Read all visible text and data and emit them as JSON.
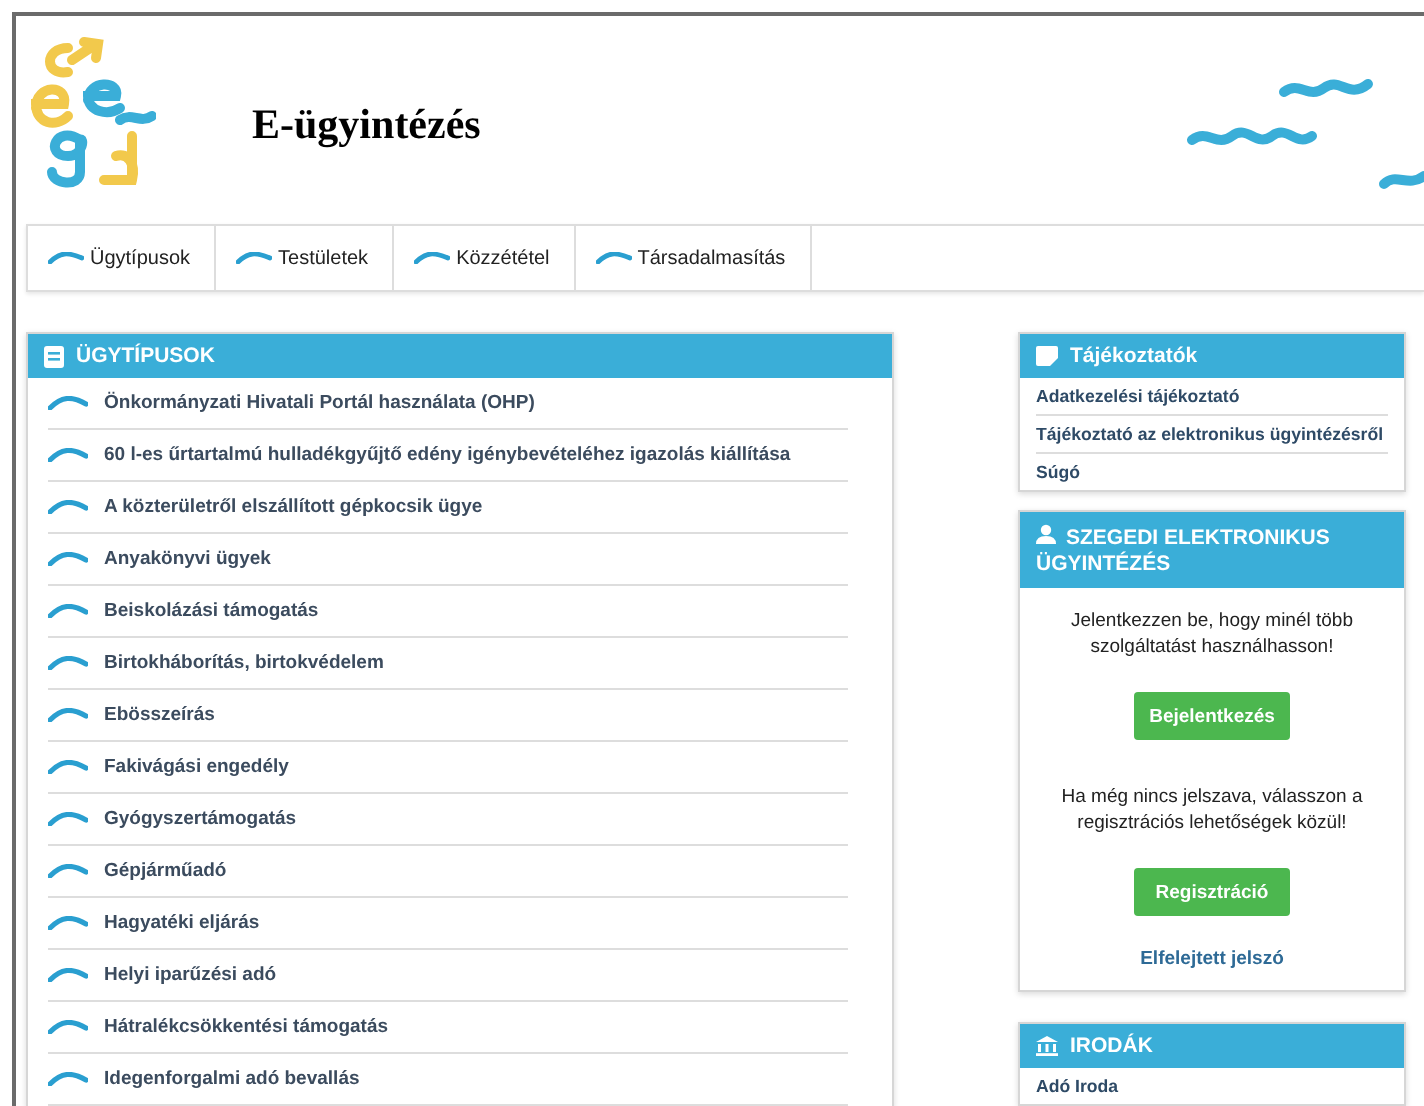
{
  "site": {
    "title": "E-ügyintézés"
  },
  "nav": [
    {
      "label": "Ügytípusok"
    },
    {
      "label": "Testületek"
    },
    {
      "label": "Közzététel"
    },
    {
      "label": "Társadalmasítás"
    }
  ],
  "case_types": {
    "title": "ÜGYTÍPUSOK",
    "items": [
      "Önkormányzati Hivatali Portál használata (OHP)",
      "60 l-es űrtartalmú hulladékgyűjtő edény igénybevételéhez igazolás kiállítása",
      "A közterületről elszállított gépkocsik ügye",
      "Anyakönyvi ügyek",
      "Beiskolázási támogatás",
      "Birtokháborítás, birtokvédelem",
      "Ebösszeírás",
      "Fakivágási engedély",
      "Gyógyszertámogatás",
      "Gépjárműadó",
      "Hagyatéki eljárás",
      "Helyi iparűzési adó",
      "Hátralékcsökkentési támogatás",
      "Idegenforgalmi adó bevallás"
    ]
  },
  "info": {
    "title": "Tájékoztatók",
    "links": [
      "Adatkezelési tájékoztató",
      "Tájékoztató az elektronikus ügyintézésről",
      "Súgó"
    ]
  },
  "login": {
    "title": "SZEGEDI ELEKTRONIKUS ÜGYINTÉZÉS",
    "prompt": "Jelentkezzen be, hogy minél több szolgáltatást használhasson!",
    "login_button": "Bejelentkezés",
    "register_prompt": "Ha még nincs jelszava, válasszon a regisztrációs lehetőségek közül!",
    "register_button": "Regisztráció",
    "forgot_link": "Elfelejtett jelszó"
  },
  "offices": {
    "title": "IRODÁK",
    "links": [
      "Adó Iroda"
    ]
  }
}
